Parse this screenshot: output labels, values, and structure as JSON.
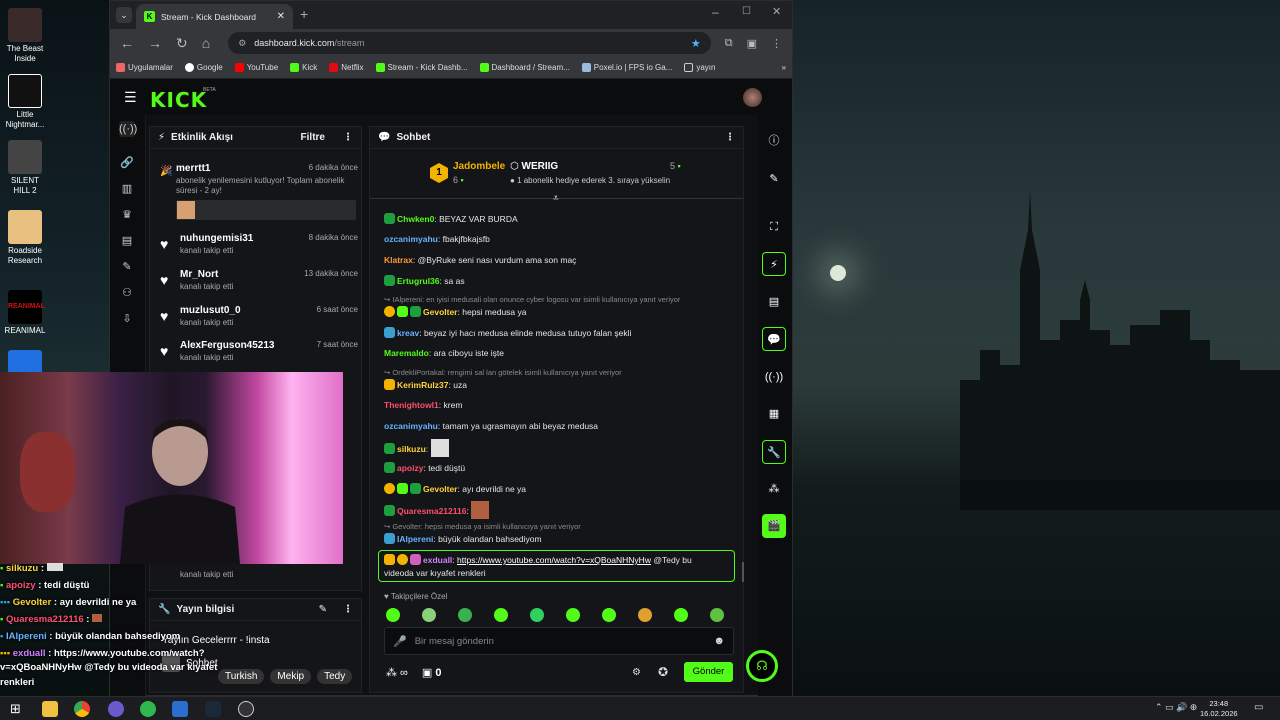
{
  "browser": {
    "tab_title": "Stream - Kick Dashboard",
    "url_host": "dashboard.kick.com",
    "url_path": "/stream",
    "bookmarks": [
      "Uygulamalar",
      "Google",
      "YouTube",
      "Kick",
      "Netflix",
      "Stream - Kick Dashb...",
      "Dashboard / Stream...",
      "Poxel.io | FPS io Ga...",
      "yayın"
    ]
  },
  "desktop_icons": [
    {
      "label": "The Beast Inside",
      "color": "#3a2a2a"
    },
    {
      "label": "Little Nightmar...",
      "color": "#ffffff"
    },
    {
      "label": "SILENT HILL 2",
      "color": "#444444"
    },
    {
      "label": "Roadside Research",
      "color": "#e8c080"
    },
    {
      "label": "REANIMAL",
      "color": "#aa1111"
    }
  ],
  "kick": {
    "logo": "KICK",
    "beta": "BETA",
    "activity": {
      "title": "Etkinlik Akışı",
      "filter": "Filtre",
      "events": [
        {
          "name": "merrtt1",
          "time": "6 dakika önce",
          "sub": "abonelik yenilemesini kutluyor! Toplam abonelik süresi - 2 ay!"
        },
        {
          "name": "nuhungemisi31",
          "time": "8 dakika önce",
          "sub": "kanalı takip etti"
        },
        {
          "name": "Mr_Nort",
          "time": "13 dakika önce",
          "sub": "kanalı takip etti"
        },
        {
          "name": "muzlusut0_0",
          "time": "6 saat önce",
          "sub": "kanalı takip etti"
        },
        {
          "name": "AlexFerguson45213",
          "time": "7 saat önce",
          "sub": "kanalı takip etti"
        }
      ],
      "last_sub": "kanalı takip etti"
    },
    "stream_info": {
      "title": "Yayın bilgisi",
      "stream_name": "Yaylın Gecelerrrr - !insta",
      "category": "Sohbet",
      "tags": [
        "Turkish",
        "Mekip",
        "Tedy"
      ]
    },
    "chat": {
      "title": "Sohbet",
      "leader1": {
        "name": "Jadombele",
        "count": "6",
        "rank": "1"
      },
      "leader2": {
        "name": "WERIIG",
        "count": "5",
        "note": "1 abonelik hediye ederek 3. sıraya yükselin"
      },
      "messages": [
        {
          "user": "Chwken0",
          "color": "#53fc18",
          "text": "BEYAZ VAR BURDA"
        },
        {
          "user": "ozcanimyahu",
          "color": "#66b3ff",
          "text": "fbakjfbkajsfb"
        },
        {
          "user": "Klatrax",
          "color": "#ff9a3c",
          "text": "@ByRuke seni nası vurdum ama son maç"
        },
        {
          "user": "Ertugrul36",
          "color": "#53fc18",
          "text": "sa as"
        },
        {
          "reply": "IAlpereni: en iyisi medusali olan onunce cyber logosu var isimli kullanıcıya yanıt veriyor"
        },
        {
          "user": "Gevolter",
          "color": "#ffd23c",
          "text": "hepsi medusa ya"
        },
        {
          "user": "kreav",
          "color": "#66b3ff",
          "text": "beyaz iyi hacı medusa elinde medusa tutuyo falan şekli"
        },
        {
          "user": "Maremaldo",
          "color": "#53fc18",
          "text": "ara ciboyu iste işte"
        },
        {
          "reply": "OrdekliPortakal: rengimi sal lan götelek isimli kullanıcıya yanıt veriyor"
        },
        {
          "user": "KerimRulz37",
          "color": "#ffd23c",
          "text": "uza"
        },
        {
          "user": "Thenightowl1",
          "color": "#ff4d6d",
          "text": "krem"
        },
        {
          "user": "ozcanimyahu",
          "color": "#66b3ff",
          "text": "tamam ya ugrasmayın abi beyaz medusa"
        },
        {
          "user": "silkuzu",
          "color": "#ffd23c",
          "text": ""
        },
        {
          "user": "apoizy",
          "color": "#ff4d6d",
          "text": "tedi düştü"
        },
        {
          "user": "Gevolter",
          "color": "#ffd23c",
          "text": "ayı devrildi ne ya"
        },
        {
          "user": "Quaresma212116",
          "color": "#ff4d6d",
          "text": ""
        },
        {
          "reply": "Gevolter: hepsi medusa ya isimli kullanıcıya yanıt veriyor"
        },
        {
          "user": "IAlpereni",
          "color": "#66b3ff",
          "text": "büyük olandan bahsediyom"
        }
      ],
      "highlight_user": "exduall",
      "highlight_link": "https://www.youtube.com/watch?v=xQBoaNHNyHw",
      "highlight_text1": "@Tedy bu",
      "highlight_text2": "videoda var kıyafet renkleri",
      "emote_label": "Takipçilere Özel",
      "input_placeholder": "Bir mesaj gönderin",
      "count": "0",
      "send": "Gönder"
    }
  },
  "overlay_chat": [
    {
      "user": "silkuzu",
      "color": "#ffd23c",
      "text": " :"
    },
    {
      "user": "apoizy",
      "color": "#ff4d6d",
      "text": " : tedi düştü"
    },
    {
      "user": "Gevolter",
      "color": "#ffd23c",
      "text": " : ayı devrildi ne ya"
    },
    {
      "user": "Quaresma212116",
      "color": "#ff4d6d",
      "text": " :"
    },
    {
      "user": "IAlpereni",
      "color": "#66b3ff",
      "text": " : büyük olandan bahsediyom"
    },
    {
      "user": "exduall",
      "color": "#d080ff",
      "text": " : https://www.youtube.com/watch?"
    },
    {
      "user": "",
      "color": "#ffffff",
      "text": "v=xQBoaNHNyHw @Tedy bu videoda var kıyafet"
    },
    {
      "user": "",
      "color": "#ffffff",
      "text": "renkleri"
    }
  ],
  "taskbar": {
    "time": "23:48",
    "date": "16.02.2026"
  }
}
